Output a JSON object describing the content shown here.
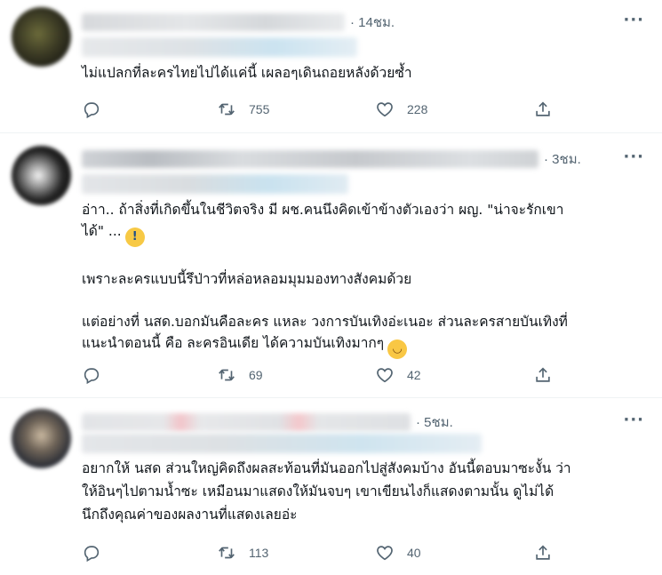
{
  "tweets": [
    {
      "time": "14ชม.",
      "more_label": "···",
      "text": "ไม่แปลกที่ละครไทยไปได้แค่นี้ เผลอๆเดินถอยหลังด้วยซ้ำ",
      "retweets": "755",
      "likes": "228"
    },
    {
      "time": "3ชม.",
      "more_label": "···",
      "text_para1_line1": "อ่าา.. ถ้าสิ่งที่เกิดขึ้นในชีวิตจริง มี ผช.คนนึงคิดเข้าข้างตัวเองว่า ผญ. \"น่าจะรักเขา",
      "text_para1_line2": "ได้\" ...",
      "text_para2": "เพราะละครแบบนี้รึป่าวที่หล่อหลอมมุมมองทางสังคมด้วย",
      "text_para3": "แต่อย่างที่ นสด.บอกมันคือละคร แหละ วงการบันเทิงอ่ะเนอะ ส่วนละครสายบันเทิงที่\nแนะนำตอนนี้ คือ ละครอินเดีย ได้ความบันเทิงมากๆ",
      "retweets": "69",
      "likes": "42"
    },
    {
      "time": "5ชม.",
      "more_label": "···",
      "text": "อยากให้ นสด ส่วนใหญ่คิดถึงผลสะท้อนที่มันออกไปสู่สังคมบ้าง อันนี้ตอบมาซะงั้น ว่า\nให้อินๆไปตามน้ำซะ เหมือนมาแสดงให้มันจบๆ เขาเขียนไงก็แสดงตามนั้น ดูไม่ได้\nนึกถึงคุณค่าของผลงานที่แสดงเลยอ่ะ",
      "retweets": "113",
      "likes": "40"
    }
  ],
  "icons": {
    "reply": "reply-icon",
    "retweet": "retweet-icon",
    "like": "heart-icon",
    "share": "share-icon",
    "emoji_1": "face-screaming-emoji",
    "emoji_2": "smirking-face-emoji"
  },
  "colors": {
    "text": "#0f1419",
    "secondary": "#536471",
    "divider": "#eff3f4"
  }
}
